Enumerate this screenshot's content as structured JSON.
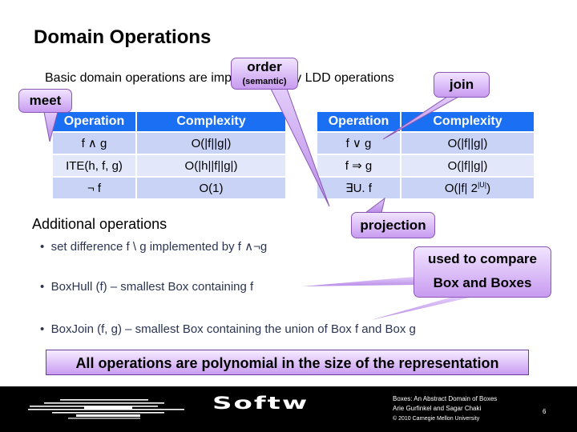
{
  "slide": {
    "title": "Domain Operations",
    "intro": "Basic domain operations are implemented by LDD operations",
    "table_left": {
      "headers": [
        "Operation",
        "Complexity"
      ],
      "rows": [
        [
          "f ∧ g",
          "O(|f||g|)"
        ],
        [
          "ITE(h, f, g)",
          "O(|h||f||g|)"
        ],
        [
          "¬ f",
          "O(1)"
        ]
      ]
    },
    "table_right": {
      "headers": [
        "Operation",
        "Complexity"
      ],
      "rows": [
        [
          "f ∨ g",
          "O(|f||g|)"
        ],
        [
          "f ⇒ g",
          "O(|f||g|)"
        ],
        [
          "∃U. f",
          "O(|f| 2",
          "|U|",
          ")"
        ]
      ]
    },
    "additional_heading": "Additional operations",
    "bullets": [
      "set difference f \\ g  implemented by f ∧¬g",
      "BoxHull (f) – smallest Box containing f",
      "BoxJoin (f, g) – smallest Box containing the union of Box f and Box g"
    ],
    "banner": "All operations are polynomial in the size of the representation"
  },
  "callouts": {
    "order": "order",
    "order_sub": "(semantic)",
    "meet": "meet",
    "join": "join",
    "projection": "projection",
    "compare_line1": "used to compare",
    "compare_line2": "Box and Boxes"
  },
  "footer": {
    "logo_text": "Softw",
    "line1": "Boxes: An Abstract Domain of Boxes",
    "line2": "Arie Gurfinkel and Sagar Chaki",
    "copyright": "© 2010 Carnegie Mellon University",
    "page_number": "6"
  },
  "colors": {
    "header_blue": "#1a6ff2",
    "row_light_blue": "#c9d3f5",
    "callout_purple": "#c89bf0",
    "bullet_text": "#2b3552"
  }
}
